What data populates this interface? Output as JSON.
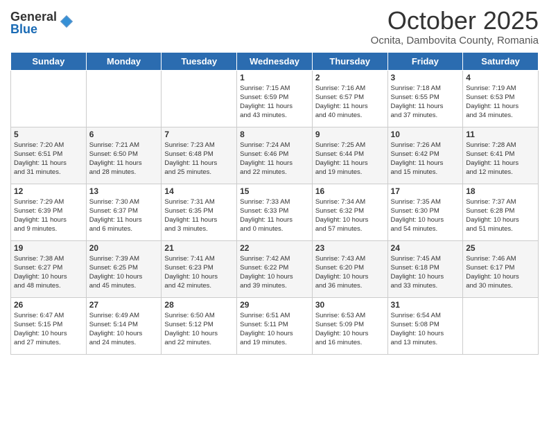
{
  "logo": {
    "general": "General",
    "blue": "Blue"
  },
  "header": {
    "month": "October 2025",
    "location": "Ocnita, Dambovita County, Romania"
  },
  "weekdays": [
    "Sunday",
    "Monday",
    "Tuesday",
    "Wednesday",
    "Thursday",
    "Friday",
    "Saturday"
  ],
  "weeks": [
    [
      {
        "day": "",
        "info": ""
      },
      {
        "day": "",
        "info": ""
      },
      {
        "day": "",
        "info": ""
      },
      {
        "day": "1",
        "info": "Sunrise: 7:15 AM\nSunset: 6:59 PM\nDaylight: 11 hours\nand 43 minutes."
      },
      {
        "day": "2",
        "info": "Sunrise: 7:16 AM\nSunset: 6:57 PM\nDaylight: 11 hours\nand 40 minutes."
      },
      {
        "day": "3",
        "info": "Sunrise: 7:18 AM\nSunset: 6:55 PM\nDaylight: 11 hours\nand 37 minutes."
      },
      {
        "day": "4",
        "info": "Sunrise: 7:19 AM\nSunset: 6:53 PM\nDaylight: 11 hours\nand 34 minutes."
      }
    ],
    [
      {
        "day": "5",
        "info": "Sunrise: 7:20 AM\nSunset: 6:51 PM\nDaylight: 11 hours\nand 31 minutes."
      },
      {
        "day": "6",
        "info": "Sunrise: 7:21 AM\nSunset: 6:50 PM\nDaylight: 11 hours\nand 28 minutes."
      },
      {
        "day": "7",
        "info": "Sunrise: 7:23 AM\nSunset: 6:48 PM\nDaylight: 11 hours\nand 25 minutes."
      },
      {
        "day": "8",
        "info": "Sunrise: 7:24 AM\nSunset: 6:46 PM\nDaylight: 11 hours\nand 22 minutes."
      },
      {
        "day": "9",
        "info": "Sunrise: 7:25 AM\nSunset: 6:44 PM\nDaylight: 11 hours\nand 19 minutes."
      },
      {
        "day": "10",
        "info": "Sunrise: 7:26 AM\nSunset: 6:42 PM\nDaylight: 11 hours\nand 15 minutes."
      },
      {
        "day": "11",
        "info": "Sunrise: 7:28 AM\nSunset: 6:41 PM\nDaylight: 11 hours\nand 12 minutes."
      }
    ],
    [
      {
        "day": "12",
        "info": "Sunrise: 7:29 AM\nSunset: 6:39 PM\nDaylight: 11 hours\nand 9 minutes."
      },
      {
        "day": "13",
        "info": "Sunrise: 7:30 AM\nSunset: 6:37 PM\nDaylight: 11 hours\nand 6 minutes."
      },
      {
        "day": "14",
        "info": "Sunrise: 7:31 AM\nSunset: 6:35 PM\nDaylight: 11 hours\nand 3 minutes."
      },
      {
        "day": "15",
        "info": "Sunrise: 7:33 AM\nSunset: 6:33 PM\nDaylight: 11 hours\nand 0 minutes."
      },
      {
        "day": "16",
        "info": "Sunrise: 7:34 AM\nSunset: 6:32 PM\nDaylight: 10 hours\nand 57 minutes."
      },
      {
        "day": "17",
        "info": "Sunrise: 7:35 AM\nSunset: 6:30 PM\nDaylight: 10 hours\nand 54 minutes."
      },
      {
        "day": "18",
        "info": "Sunrise: 7:37 AM\nSunset: 6:28 PM\nDaylight: 10 hours\nand 51 minutes."
      }
    ],
    [
      {
        "day": "19",
        "info": "Sunrise: 7:38 AM\nSunset: 6:27 PM\nDaylight: 10 hours\nand 48 minutes."
      },
      {
        "day": "20",
        "info": "Sunrise: 7:39 AM\nSunset: 6:25 PM\nDaylight: 10 hours\nand 45 minutes."
      },
      {
        "day": "21",
        "info": "Sunrise: 7:41 AM\nSunset: 6:23 PM\nDaylight: 10 hours\nand 42 minutes."
      },
      {
        "day": "22",
        "info": "Sunrise: 7:42 AM\nSunset: 6:22 PM\nDaylight: 10 hours\nand 39 minutes."
      },
      {
        "day": "23",
        "info": "Sunrise: 7:43 AM\nSunset: 6:20 PM\nDaylight: 10 hours\nand 36 minutes."
      },
      {
        "day": "24",
        "info": "Sunrise: 7:45 AM\nSunset: 6:18 PM\nDaylight: 10 hours\nand 33 minutes."
      },
      {
        "day": "25",
        "info": "Sunrise: 7:46 AM\nSunset: 6:17 PM\nDaylight: 10 hours\nand 30 minutes."
      }
    ],
    [
      {
        "day": "26",
        "info": "Sunrise: 6:47 AM\nSunset: 5:15 PM\nDaylight: 10 hours\nand 27 minutes."
      },
      {
        "day": "27",
        "info": "Sunrise: 6:49 AM\nSunset: 5:14 PM\nDaylight: 10 hours\nand 24 minutes."
      },
      {
        "day": "28",
        "info": "Sunrise: 6:50 AM\nSunset: 5:12 PM\nDaylight: 10 hours\nand 22 minutes."
      },
      {
        "day": "29",
        "info": "Sunrise: 6:51 AM\nSunset: 5:11 PM\nDaylight: 10 hours\nand 19 minutes."
      },
      {
        "day": "30",
        "info": "Sunrise: 6:53 AM\nSunset: 5:09 PM\nDaylight: 10 hours\nand 16 minutes."
      },
      {
        "day": "31",
        "info": "Sunrise: 6:54 AM\nSunset: 5:08 PM\nDaylight: 10 hours\nand 13 minutes."
      },
      {
        "day": "",
        "info": ""
      }
    ]
  ]
}
